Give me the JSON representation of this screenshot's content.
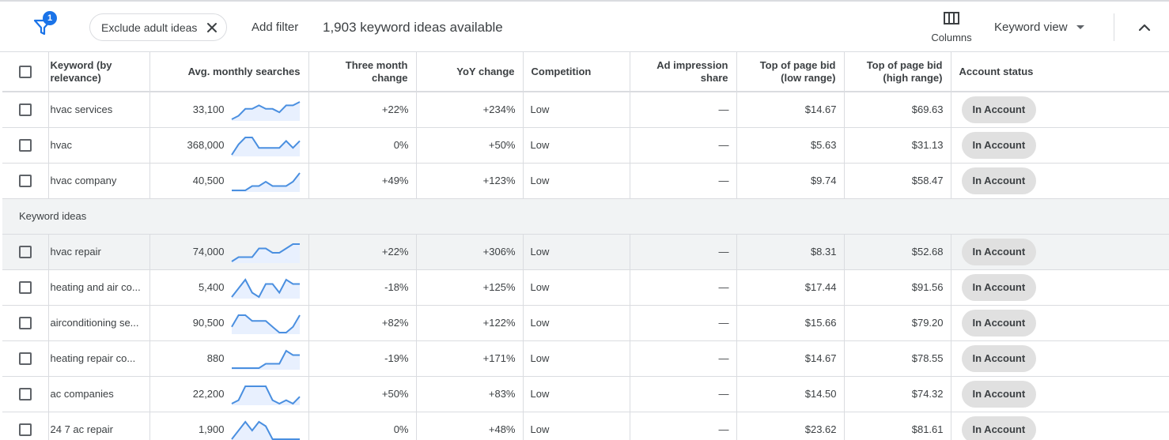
{
  "toolbar": {
    "filter_count": "1",
    "chip_label": "Exclude adult ideas",
    "add_filter": "Add filter",
    "ideas_count": "1,903 keyword ideas available",
    "columns_label": "Columns",
    "keyword_view_label": "Keyword view"
  },
  "columns": {
    "keyword": "Keyword (by relevance)",
    "searches": "Avg. monthly searches",
    "three_month": "Three month change",
    "yoy": "YoY change",
    "competition": "Competition",
    "ad_share": "Ad impression share",
    "bid_low": "Top of page bid (low range)",
    "bid_high": "Top of page bid (high range)",
    "status": "Account status"
  },
  "section_label": "Keyword ideas",
  "rows": [
    {
      "keyword": "hvac services",
      "searches": "33,100",
      "three_month": "+22%",
      "yoy": "+234%",
      "competition": "Low",
      "ad_share": "—",
      "bid_low": "$14.67",
      "bid_high": "$69.63",
      "status": "In Account",
      "trend": [
        2,
        3,
        5,
        5,
        6,
        5,
        5,
        4,
        6,
        6,
        7
      ]
    },
    {
      "keyword": "hvac",
      "searches": "368,000",
      "three_month": "0%",
      "yoy": "+50%",
      "competition": "Low",
      "ad_share": "—",
      "bid_low": "$5.63",
      "bid_high": "$31.13",
      "status": "In Account",
      "trend": [
        1,
        4,
        6,
        6,
        3,
        3,
        3,
        3,
        5,
        3,
        5
      ]
    },
    {
      "keyword": "hvac company",
      "searches": "40,500",
      "three_month": "+49%",
      "yoy": "+123%",
      "competition": "Low",
      "ad_share": "—",
      "bid_low": "$9.74",
      "bid_high": "$58.47",
      "status": "In Account",
      "trend": [
        1,
        1,
        1,
        2,
        2,
        3,
        2,
        2,
        2,
        3,
        5
      ]
    },
    {
      "keyword": "hvac repair",
      "searches": "74,000",
      "three_month": "+22%",
      "yoy": "+306%",
      "competition": "Low",
      "ad_share": "—",
      "bid_low": "$8.31",
      "bid_high": "$52.68",
      "status": "In Account",
      "trend": [
        1,
        2,
        2,
        2,
        4,
        4,
        3,
        3,
        4,
        5,
        5
      ]
    },
    {
      "keyword": "heating and air co...",
      "searches": "5,400",
      "three_month": "-18%",
      "yoy": "+125%",
      "competition": "Low",
      "ad_share": "—",
      "bid_low": "$17.44",
      "bid_high": "$91.56",
      "status": "In Account",
      "trend": [
        2,
        4,
        6,
        3,
        2,
        5,
        5,
        3,
        6,
        5,
        5
      ]
    },
    {
      "keyword": "airconditioning se...",
      "searches": "90,500",
      "three_month": "+82%",
      "yoy": "+122%",
      "competition": "Low",
      "ad_share": "—",
      "bid_low": "$15.66",
      "bid_high": "$79.20",
      "status": "In Account",
      "trend": [
        3,
        5,
        5,
        4,
        4,
        4,
        3,
        2,
        2,
        3,
        5
      ]
    },
    {
      "keyword": "heating repair co...",
      "searches": "880",
      "three_month": "-19%",
      "yoy": "+171%",
      "competition": "Low",
      "ad_share": "—",
      "bid_low": "$14.67",
      "bid_high": "$78.55",
      "status": "In Account",
      "trend": [
        2,
        2,
        2,
        2,
        2,
        3,
        3,
        3,
        6,
        5,
        5
      ]
    },
    {
      "keyword": "ac companies",
      "searches": "22,200",
      "three_month": "+50%",
      "yoy": "+83%",
      "competition": "Low",
      "ad_share": "—",
      "bid_low": "$14.50",
      "bid_high": "$74.32",
      "status": "In Account",
      "trend": [
        1,
        2,
        6,
        6,
        6,
        6,
        2,
        1,
        2,
        1,
        3
      ]
    },
    {
      "keyword": "24 7 ac repair",
      "searches": "1,900",
      "three_month": "0%",
      "yoy": "+48%",
      "competition": "Low",
      "ad_share": "—",
      "bid_low": "$23.62",
      "bid_high": "$81.61",
      "status": "In Account",
      "trend": [
        1,
        3,
        5,
        3,
        5,
        4,
        1,
        1,
        1,
        1,
        1
      ]
    }
  ],
  "colors": {
    "sparkline": "#4a8fe0",
    "sparkline_fill": "#e8f0fe",
    "accent": "#1a73e8"
  }
}
